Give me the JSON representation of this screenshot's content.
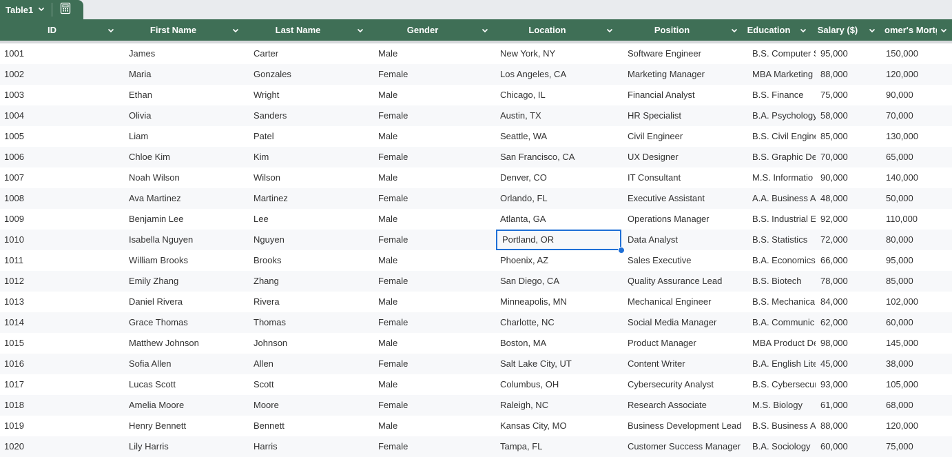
{
  "table_tab": {
    "name": "Table1"
  },
  "columns": [
    {
      "key": "id",
      "label": "ID"
    },
    {
      "key": "first_name",
      "label": "First Name"
    },
    {
      "key": "last_name",
      "label": "Last Name"
    },
    {
      "key": "gender",
      "label": "Gender"
    },
    {
      "key": "location",
      "label": "Location"
    },
    {
      "key": "position",
      "label": "Position"
    },
    {
      "key": "education",
      "label": "Education"
    },
    {
      "key": "salary",
      "label": "Salary ($)"
    },
    {
      "key": "mortgage",
      "label": "omer's Mortg"
    }
  ],
  "rows": [
    [
      "1001",
      "James",
      "Carter",
      "Male",
      "New York, NY",
      "Software Engineer",
      "B.S. Computer S",
      "95,000",
      "150,000"
    ],
    [
      "1002",
      "Maria",
      "Gonzales",
      "Female",
      "Los Angeles, CA",
      "Marketing Manager",
      "MBA Marketing",
      "88,000",
      "120,000"
    ],
    [
      "1003",
      "Ethan",
      "Wright",
      "Male",
      "Chicago, IL",
      "Financial Analyst",
      "B.S. Finance",
      "75,000",
      "90,000"
    ],
    [
      "1004",
      "Olivia",
      "Sanders",
      "Female",
      "Austin, TX",
      "HR Specialist",
      "B.A. Psychology",
      "58,000",
      "70,000"
    ],
    [
      "1005",
      "Liam",
      "Patel",
      "Male",
      "Seattle, WA",
      "Civil Engineer",
      "B.S. Civil Engine",
      "85,000",
      "130,000"
    ],
    [
      "1006",
      "Chloe Kim",
      " Kim",
      "Female",
      "San Francisco, CA",
      "UX Designer",
      "B.S. Graphic De",
      "70,000",
      "65,000"
    ],
    [
      "1007",
      "Noah Wilson",
      " Wilson",
      "Male",
      "Denver, CO",
      "IT Consultant",
      "M.S. Informatio",
      "90,000",
      "140,000"
    ],
    [
      "1008",
      "Ava Martinez",
      " Martinez",
      "Female",
      "Orlando, FL",
      "Executive Assistant",
      "A.A. Business A",
      "48,000",
      "50,000"
    ],
    [
      "1009",
      "Benjamin Lee",
      " Lee",
      "Male",
      "Atlanta, GA",
      "Operations Manager",
      "B.S. Industrial E",
      "92,000",
      "110,000"
    ],
    [
      "1010",
      "Isabella Nguyen",
      "Nguyen",
      "Female",
      "Portland, OR",
      "Data Analyst",
      "B.S. Statistics",
      "72,000",
      "80,000"
    ],
    [
      "1011",
      "William Brooks",
      " Brooks",
      "Male",
      "Phoenix, AZ",
      "Sales Executive",
      "B.A. Economics",
      "66,000",
      "95,000"
    ],
    [
      "1012",
      "Emily Zhang",
      "Zhang",
      "Female",
      "San Diego, CA",
      "Quality Assurance Lead",
      "B.S. Biotech",
      "78,000",
      "85,000"
    ],
    [
      "1013",
      "Daniel Rivera",
      " Rivera",
      "Male",
      "Minneapolis, MN",
      "Mechanical Engineer",
      "B.S. Mechanica",
      "84,000",
      "102,000"
    ],
    [
      "1014",
      "Grace Thomas",
      "Thomas",
      "Female",
      "Charlotte, NC",
      "Social Media Manager",
      "B.A. Communic",
      "62,000",
      "60,000"
    ],
    [
      "1015",
      "Matthew Johnson",
      " Johnson",
      "Male",
      "Boston, MA",
      "Product Manager",
      "MBA Product De",
      "98,000",
      "145,000"
    ],
    [
      "1016",
      "Sofia Allen",
      " Allen",
      "Female",
      "Salt Lake City, UT",
      "Content Writer",
      "B.A. English Lite",
      "45,000",
      "38,000"
    ],
    [
      "1017",
      "Lucas Scott",
      " Scott",
      "Male",
      "Columbus, OH",
      "Cybersecurity Analyst",
      "B.S. Cybersecur",
      "93,000",
      "105,000"
    ],
    [
      "1018",
      "Amelia Moore",
      " Moore",
      "Female",
      "Raleigh, NC",
      "Research Associate",
      "M.S. Biology",
      "61,000",
      "68,000"
    ],
    [
      "1019",
      "Henry Bennett",
      "Bennett",
      "Male",
      "Kansas City, MO",
      "Business Development Lead",
      "B.S. Business A",
      "88,000",
      "120,000"
    ],
    [
      "1020",
      "Lily Harris",
      " Harris",
      "Female",
      "Tampa, FL",
      "Customer Success Manager",
      "B.A. Sociology",
      "60,000",
      "75,000"
    ]
  ],
  "selected_cell": {
    "row": 9,
    "col": 4
  },
  "colors": {
    "header_bg": "#3f6f56",
    "header_text": "#ffffff",
    "selection": "#1f6fd6",
    "alt_row": "#f7f8fa"
  },
  "icons": {
    "tab_dropdown": "chevron-down-icon",
    "table_calc": "calculator-icon",
    "column_menu": "chevron-down-icon",
    "fill_handle": "fill-handle"
  }
}
